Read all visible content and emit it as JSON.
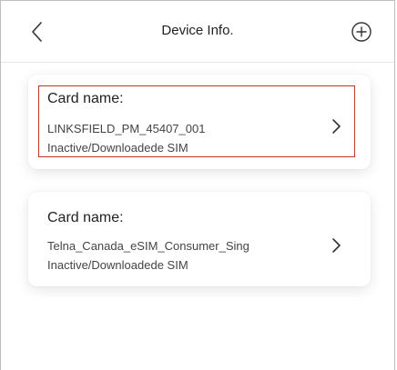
{
  "header": {
    "title": "Device Info.",
    "back_icon": "chevron-left-icon",
    "add_icon": "plus-circle-icon"
  },
  "cards": [
    {
      "title": "Card name:",
      "name": "LINKSFIELD_PM_45407_001",
      "status": "Inactive/Downloadede SIM",
      "highlighted": true
    },
    {
      "title": "Card name:",
      "name": "Telna_Canada_eSIM_Consumer_Sing",
      "status": "Inactive/Downloadede SIM",
      "highlighted": false
    }
  ],
  "colors": {
    "highlight_border": "#c0392b",
    "text_primary": "#222222",
    "text_secondary": "#444444"
  }
}
